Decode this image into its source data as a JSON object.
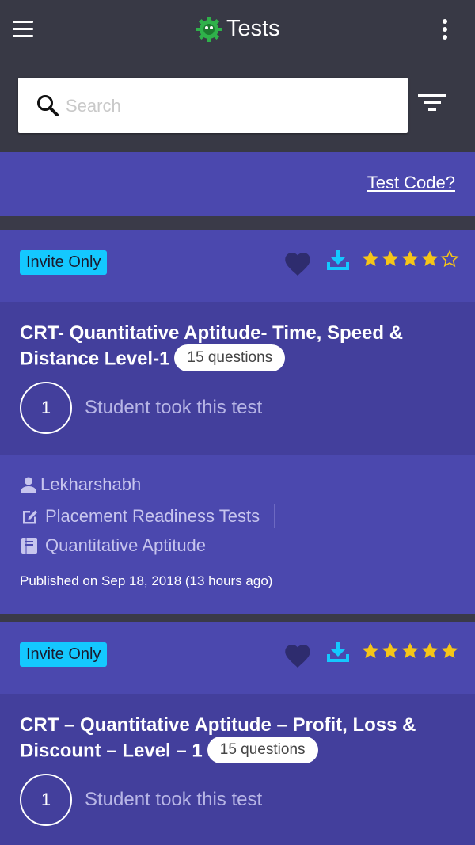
{
  "appbar": {
    "title": "Tests",
    "menu_icon": "hamburger-menu-icon",
    "more_icon": "more-vertical-icon",
    "logo_icon": "gear-robot-logo-icon"
  },
  "search": {
    "placeholder": "Search",
    "value": "",
    "icon": "search-icon",
    "filter_icon": "filter-icon"
  },
  "test_code_link": "Test Code?",
  "colors": {
    "appbar": "#383945",
    "primary": "#4b48ae",
    "body": "#433f9c",
    "badge": "#14c8ff",
    "star": "#f5c518",
    "download": "#14c8ff",
    "heart": "#2e2c6e"
  },
  "tests": [
    {
      "badge": "Invite Only",
      "rating": 4,
      "rating_max": 5,
      "title": "CRT- Quantitative Aptitude- Time, Speed & Distance Level-1",
      "question_count": "15 questions",
      "students_count": "1",
      "students_label": "Student took this test",
      "author": "Lekharshabh",
      "category": "Placement Readiness Tests",
      "subject": "Quantitative Aptitude",
      "published": "Published on Sep 18, 2018 (13 hours ago)"
    },
    {
      "badge": "Invite Only",
      "rating": 5,
      "rating_max": 5,
      "title": "CRT – Quantitative Aptitude – Profit, Loss & Discount – Level – 1",
      "question_count": "15 questions",
      "students_count": "1",
      "students_label": "Student took this test"
    }
  ]
}
